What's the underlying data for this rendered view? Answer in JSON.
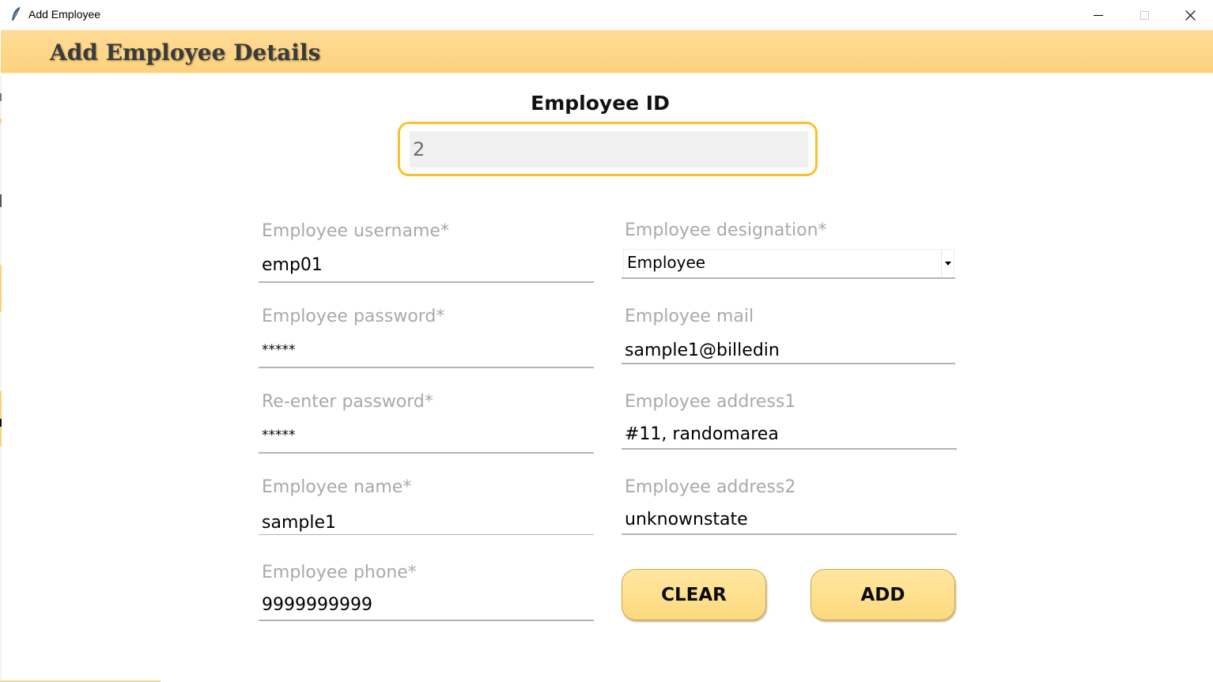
{
  "window": {
    "title": "Add Employee",
    "app_icon": "feather-icon",
    "controls": [
      "minimize-icon",
      "maximize-icon",
      "close-icon"
    ]
  },
  "header": {
    "title": "Add Employee Details",
    "background": "#fdd686"
  },
  "employee_id": {
    "label": "Employee ID",
    "value": "2",
    "border_color": "#fcc02e"
  },
  "form": {
    "username": {
      "label": "Employee username*",
      "value": "emp01"
    },
    "password": {
      "label": "Employee password*",
      "value": "*****"
    },
    "reenter_password": {
      "label": "Re-enter password*",
      "value": "*****"
    },
    "name": {
      "label": "Employee name*",
      "value": "sample1"
    },
    "phone": {
      "label": "Employee phone*",
      "value": "9999999999"
    },
    "designation": {
      "label": "Employee designation*",
      "selected": "Employee"
    },
    "mail": {
      "label": "Employee mail",
      "value": "sample1@billedin"
    },
    "address1": {
      "label": "Employee address1",
      "value": "#11, randomarea"
    },
    "address2": {
      "label": "Employee address2",
      "value": "unknownstate"
    }
  },
  "buttons": {
    "clear": "CLEAR",
    "add": "ADD",
    "color": "#fee29a"
  }
}
